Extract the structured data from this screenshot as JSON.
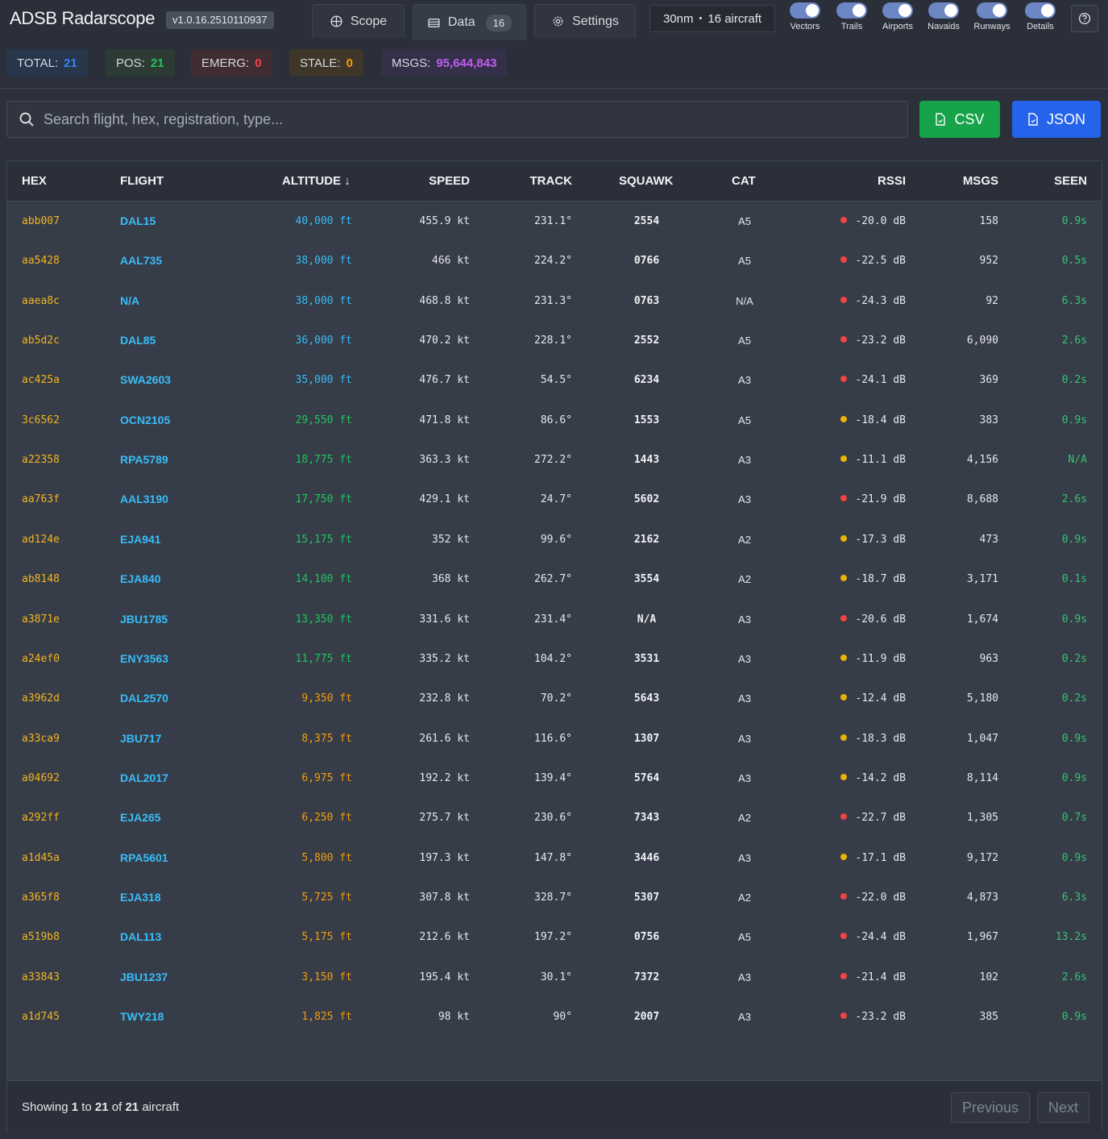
{
  "app": {
    "title": "ADSB Radarscope",
    "version": "v1.0.16.2510110937"
  },
  "tabs": [
    {
      "label": "Scope",
      "icon": "crosshair-icon"
    },
    {
      "label": "Data",
      "icon": "table-icon",
      "badge": "16",
      "active": true
    },
    {
      "label": "Settings",
      "icon": "gear-icon"
    }
  ],
  "range": {
    "distance": "30nm",
    "separator": "•",
    "aircraft": "16 aircraft"
  },
  "toggles": [
    {
      "label": "Vectors",
      "on": true
    },
    {
      "label": "Trails",
      "on": true
    },
    {
      "label": "Airports",
      "on": true
    },
    {
      "label": "Navaids",
      "on": true
    },
    {
      "label": "Runways",
      "on": true
    },
    {
      "label": "Details",
      "on": true
    }
  ],
  "stats": [
    {
      "key": "TOTAL:",
      "value": "21",
      "color": "#3b82f6",
      "bg": "#27364b"
    },
    {
      "key": "POS:",
      "value": "21",
      "color": "#22c55e",
      "bg": "#2c3b33"
    },
    {
      "key": "EMERG:",
      "value": "0",
      "color": "#ef4444",
      "bg": "#3f2d33"
    },
    {
      "key": "STALE:",
      "value": "0",
      "color": "#f59e0b",
      "bg": "#3d3629"
    },
    {
      "key": "MSGS:",
      "value": "95,644,843",
      "color": "#c05cf0",
      "bg": "#35304a"
    }
  ],
  "search": {
    "placeholder": "Search flight, hex, registration, type..."
  },
  "export": {
    "csv_label": "CSV",
    "json_label": "JSON",
    "csv_color": "#16a34a",
    "json_color": "#2563eb"
  },
  "columns": [
    "HEX",
    "FLIGHT",
    "ALTITUDE ↓",
    "SPEED",
    "TRACK",
    "SQUAWK",
    "CAT",
    "RSSI",
    "MSGS",
    "SEEN"
  ],
  "rows": [
    {
      "hex": "abb007",
      "flight": "DAL15",
      "alt": "40,000 ft",
      "alt_color": "#38bdf8",
      "speed": "455.9 kt",
      "track": "231.1°",
      "squawk": "2554",
      "cat": "A5",
      "rssi": "-20.0 dB",
      "rssi_color": "#ef4444",
      "msgs": "158",
      "seen": "0.9s"
    },
    {
      "hex": "aa5428",
      "flight": "AAL735",
      "alt": "38,000 ft",
      "alt_color": "#38bdf8",
      "speed": "466 kt",
      "track": "224.2°",
      "squawk": "0766",
      "cat": "A5",
      "rssi": "-22.5 dB",
      "rssi_color": "#ef4444",
      "msgs": "952",
      "seen": "0.5s"
    },
    {
      "hex": "aaea8c",
      "flight": "N/A",
      "alt": "38,000 ft",
      "alt_color": "#38bdf8",
      "speed": "468.8 kt",
      "track": "231.3°",
      "squawk": "0763",
      "cat": "N/A",
      "rssi": "-24.3 dB",
      "rssi_color": "#ef4444",
      "msgs": "92",
      "seen": "6.3s"
    },
    {
      "hex": "ab5d2c",
      "flight": "DAL85",
      "alt": "36,000 ft",
      "alt_color": "#38bdf8",
      "speed": "470.2 kt",
      "track": "228.1°",
      "squawk": "2552",
      "cat": "A5",
      "rssi": "-23.2 dB",
      "rssi_color": "#ef4444",
      "msgs": "6,090",
      "seen": "2.6s"
    },
    {
      "hex": "ac425a",
      "flight": "SWA2603",
      "alt": "35,000 ft",
      "alt_color": "#38bdf8",
      "speed": "476.7 kt",
      "track": "54.5°",
      "squawk": "6234",
      "cat": "A3",
      "rssi": "-24.1 dB",
      "rssi_color": "#ef4444",
      "msgs": "369",
      "seen": "0.2s"
    },
    {
      "hex": "3c6562",
      "flight": "OCN2105",
      "alt": "29,550 ft",
      "alt_color": "#22c55e",
      "speed": "471.8 kt",
      "track": "86.6°",
      "squawk": "1553",
      "cat": "A5",
      "rssi": "-18.4 dB",
      "rssi_color": "#eab308",
      "msgs": "383",
      "seen": "0.9s"
    },
    {
      "hex": "a22358",
      "flight": "RPA5789",
      "alt": "18,775 ft",
      "alt_color": "#22c55e",
      "speed": "363.3 kt",
      "track": "272.2°",
      "squawk": "1443",
      "cat": "A3",
      "rssi": "-11.1 dB",
      "rssi_color": "#eab308",
      "msgs": "4,156",
      "seen": "N/A"
    },
    {
      "hex": "aa763f",
      "flight": "AAL3190",
      "alt": "17,750 ft",
      "alt_color": "#22c55e",
      "speed": "429.1 kt",
      "track": "24.7°",
      "squawk": "5602",
      "cat": "A3",
      "rssi": "-21.9 dB",
      "rssi_color": "#ef4444",
      "msgs": "8,688",
      "seen": "2.6s"
    },
    {
      "hex": "ad124e",
      "flight": "EJA941",
      "alt": "15,175 ft",
      "alt_color": "#22c55e",
      "speed": "352 kt",
      "track": "99.6°",
      "squawk": "2162",
      "cat": "A2",
      "rssi": "-17.3 dB",
      "rssi_color": "#eab308",
      "msgs": "473",
      "seen": "0.9s"
    },
    {
      "hex": "ab8148",
      "flight": "EJA840",
      "alt": "14,100 ft",
      "alt_color": "#22c55e",
      "speed": "368 kt",
      "track": "262.7°",
      "squawk": "3554",
      "cat": "A2",
      "rssi": "-18.7 dB",
      "rssi_color": "#eab308",
      "msgs": "3,171",
      "seen": "0.1s"
    },
    {
      "hex": "a3871e",
      "flight": "JBU1785",
      "alt": "13,350 ft",
      "alt_color": "#22c55e",
      "speed": "331.6 kt",
      "track": "231.4°",
      "squawk": "N/A",
      "cat": "A3",
      "rssi": "-20.6 dB",
      "rssi_color": "#ef4444",
      "msgs": "1,674",
      "seen": "0.9s"
    },
    {
      "hex": "a24ef0",
      "flight": "ENY3563",
      "alt": "11,775 ft",
      "alt_color": "#22c55e",
      "speed": "335.2 kt",
      "track": "104.2°",
      "squawk": "3531",
      "cat": "A3",
      "rssi": "-11.9 dB",
      "rssi_color": "#eab308",
      "msgs": "963",
      "seen": "0.2s"
    },
    {
      "hex": "a3962d",
      "flight": "DAL2570",
      "alt": "9,350 ft",
      "alt_color": "#f59e0b",
      "speed": "232.8 kt",
      "track": "70.2°",
      "squawk": "5643",
      "cat": "A3",
      "rssi": "-12.4 dB",
      "rssi_color": "#eab308",
      "msgs": "5,180",
      "seen": "0.2s"
    },
    {
      "hex": "a33ca9",
      "flight": "JBU717",
      "alt": "8,375 ft",
      "alt_color": "#f59e0b",
      "speed": "261.6 kt",
      "track": "116.6°",
      "squawk": "1307",
      "cat": "A3",
      "rssi": "-18.3 dB",
      "rssi_color": "#eab308",
      "msgs": "1,047",
      "seen": "0.9s"
    },
    {
      "hex": "a04692",
      "flight": "DAL2017",
      "alt": "6,975 ft",
      "alt_color": "#f59e0b",
      "speed": "192.2 kt",
      "track": "139.4°",
      "squawk": "5764",
      "cat": "A3",
      "rssi": "-14.2 dB",
      "rssi_color": "#eab308",
      "msgs": "8,114",
      "seen": "0.9s"
    },
    {
      "hex": "a292ff",
      "flight": "EJA265",
      "alt": "6,250 ft",
      "alt_color": "#f59e0b",
      "speed": "275.7 kt",
      "track": "230.6°",
      "squawk": "7343",
      "cat": "A2",
      "rssi": "-22.7 dB",
      "rssi_color": "#ef4444",
      "msgs": "1,305",
      "seen": "0.7s"
    },
    {
      "hex": "a1d45a",
      "flight": "RPA5601",
      "alt": "5,800 ft",
      "alt_color": "#f59e0b",
      "speed": "197.3 kt",
      "track": "147.8°",
      "squawk": "3446",
      "cat": "A3",
      "rssi": "-17.1 dB",
      "rssi_color": "#eab308",
      "msgs": "9,172",
      "seen": "0.9s"
    },
    {
      "hex": "a365f8",
      "flight": "EJA318",
      "alt": "5,725 ft",
      "alt_color": "#f59e0b",
      "speed": "307.8 kt",
      "track": "328.7°",
      "squawk": "5307",
      "cat": "A2",
      "rssi": "-22.0 dB",
      "rssi_color": "#ef4444",
      "msgs": "4,873",
      "seen": "6.3s"
    },
    {
      "hex": "a519b8",
      "flight": "DAL113",
      "alt": "5,175 ft",
      "alt_color": "#f59e0b",
      "speed": "212.6 kt",
      "track": "197.2°",
      "squawk": "0756",
      "cat": "A5",
      "rssi": "-24.4 dB",
      "rssi_color": "#ef4444",
      "msgs": "1,967",
      "seen": "13.2s"
    },
    {
      "hex": "a33843",
      "flight": "JBU1237",
      "alt": "3,150 ft",
      "alt_color": "#f59e0b",
      "speed": "195.4 kt",
      "track": "30.1°",
      "squawk": "7372",
      "cat": "A3",
      "rssi": "-21.4 dB",
      "rssi_color": "#ef4444",
      "msgs": "102",
      "seen": "2.6s"
    },
    {
      "hex": "a1d745",
      "flight": "TWY218",
      "alt": "1,825 ft",
      "alt_color": "#f59e0b",
      "speed": "98 kt",
      "track": "90°",
      "squawk": "2007",
      "cat": "A3",
      "rssi": "-23.2 dB",
      "rssi_color": "#ef4444",
      "msgs": "385",
      "seen": "0.9s"
    }
  ],
  "footer": {
    "showing_prefix": "Showing",
    "from": "1",
    "to_word": "to",
    "to": "21",
    "of_word": "of",
    "total": "21",
    "suffix": "aircraft",
    "prev_label": "Previous",
    "next_label": "Next"
  }
}
